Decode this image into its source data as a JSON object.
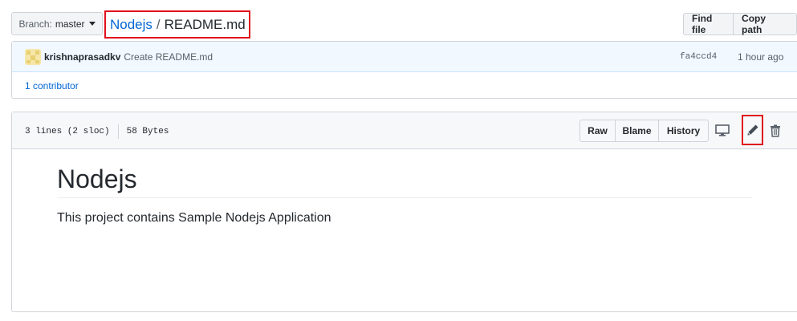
{
  "branch": {
    "label": "Branch:",
    "value": "master"
  },
  "breadcrumb": {
    "repo": "Nodejs",
    "separator": "/",
    "file": "README.md"
  },
  "file_actions": {
    "find_file": "Find file",
    "copy_path": "Copy path"
  },
  "commit": {
    "author": "krishnaprasadkv",
    "message": "Create README.md",
    "sha": "fa4ccd4",
    "time": "1 hour ago"
  },
  "contributors": {
    "label": "1 contributor"
  },
  "file_header": {
    "lines": "3 lines (2 sloc)",
    "size": "58 Bytes",
    "raw": "Raw",
    "blame": "Blame",
    "history": "History",
    "icons": [
      "desktop-icon",
      "pencil-icon",
      "trash-icon"
    ]
  },
  "readme": {
    "heading": "Nodejs",
    "body": "This project contains Sample Nodejs Application"
  },
  "colors": {
    "link": "#0366d6",
    "highlight": "#e0101a",
    "commit_bg": "#f1f8ff"
  }
}
